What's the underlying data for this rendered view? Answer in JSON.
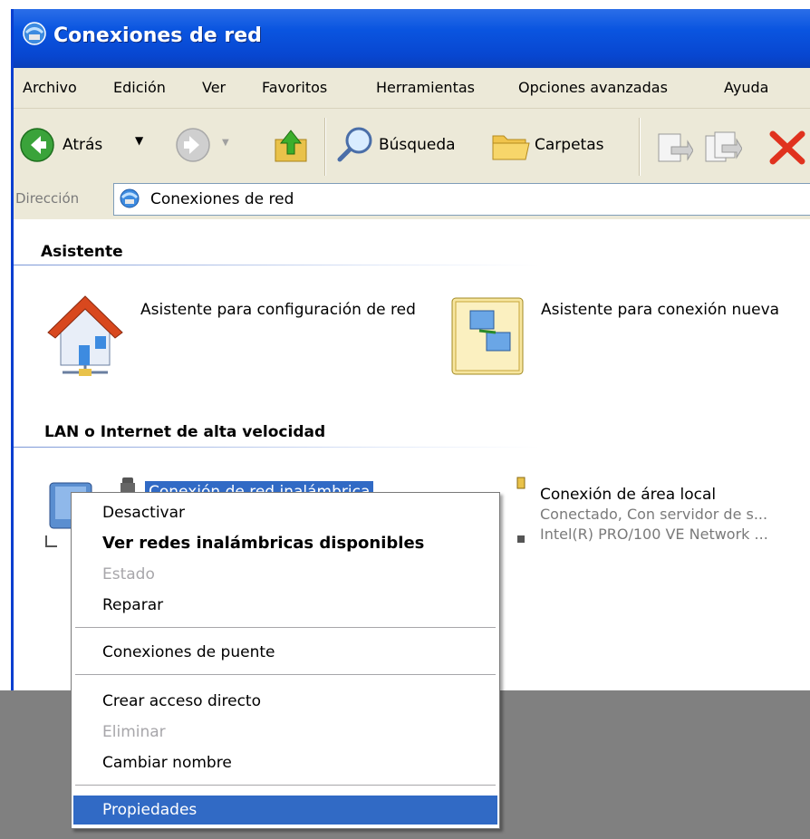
{
  "window": {
    "title": "Conexiones de red",
    "title_icon": "network-connections-icon"
  },
  "menubar": {
    "items": [
      "Archivo",
      "Edición",
      "Ver",
      "Favoritos",
      "Herramientas",
      "Opciones avanzadas",
      "Ayuda"
    ]
  },
  "toolbar": {
    "back_label": "Atrás",
    "search_label": "Búsqueda",
    "folders_label": "Carpetas"
  },
  "address": {
    "label": "Dirección",
    "value": "Conexiones de red"
  },
  "groups": {
    "wizard": {
      "title": "Asistente",
      "items": [
        {
          "label": "Asistente para configuración de red",
          "icon": "home-network-wizard-icon"
        },
        {
          "label": "Asistente para conexión nueva",
          "icon": "new-connection-wizard-icon"
        }
      ]
    },
    "lan": {
      "title": "LAN o Internet de alta velocidad",
      "items": [
        {
          "label": "Conexión de red inalámbrica",
          "icon": "wireless-connection-icon",
          "selected": true
        },
        {
          "label": "Conexión de área local",
          "status": "Conectado, Con servidor de s...",
          "device": "Intel(R) PRO/100 VE Network ...",
          "icon": "lan-connection-icon"
        }
      ]
    }
  },
  "context_menu": {
    "items": [
      {
        "label": "Desactivar"
      },
      {
        "label": "Ver redes inalámbricas disponibles",
        "bold": true
      },
      {
        "label": "Estado",
        "disabled": true
      },
      {
        "label": "Reparar"
      },
      {
        "label": "Conexiones de puente"
      },
      {
        "label": "Crear acceso directo"
      },
      {
        "label": "Eliminar",
        "disabled": true
      },
      {
        "label": "Cambiar nombre"
      },
      {
        "label": "Propiedades",
        "highlighted": true
      }
    ]
  },
  "colors": {
    "titlebar": "#0a55e0",
    "selection": "#316ac5",
    "chrome": "#ece9d8",
    "desktop": "#808080"
  }
}
